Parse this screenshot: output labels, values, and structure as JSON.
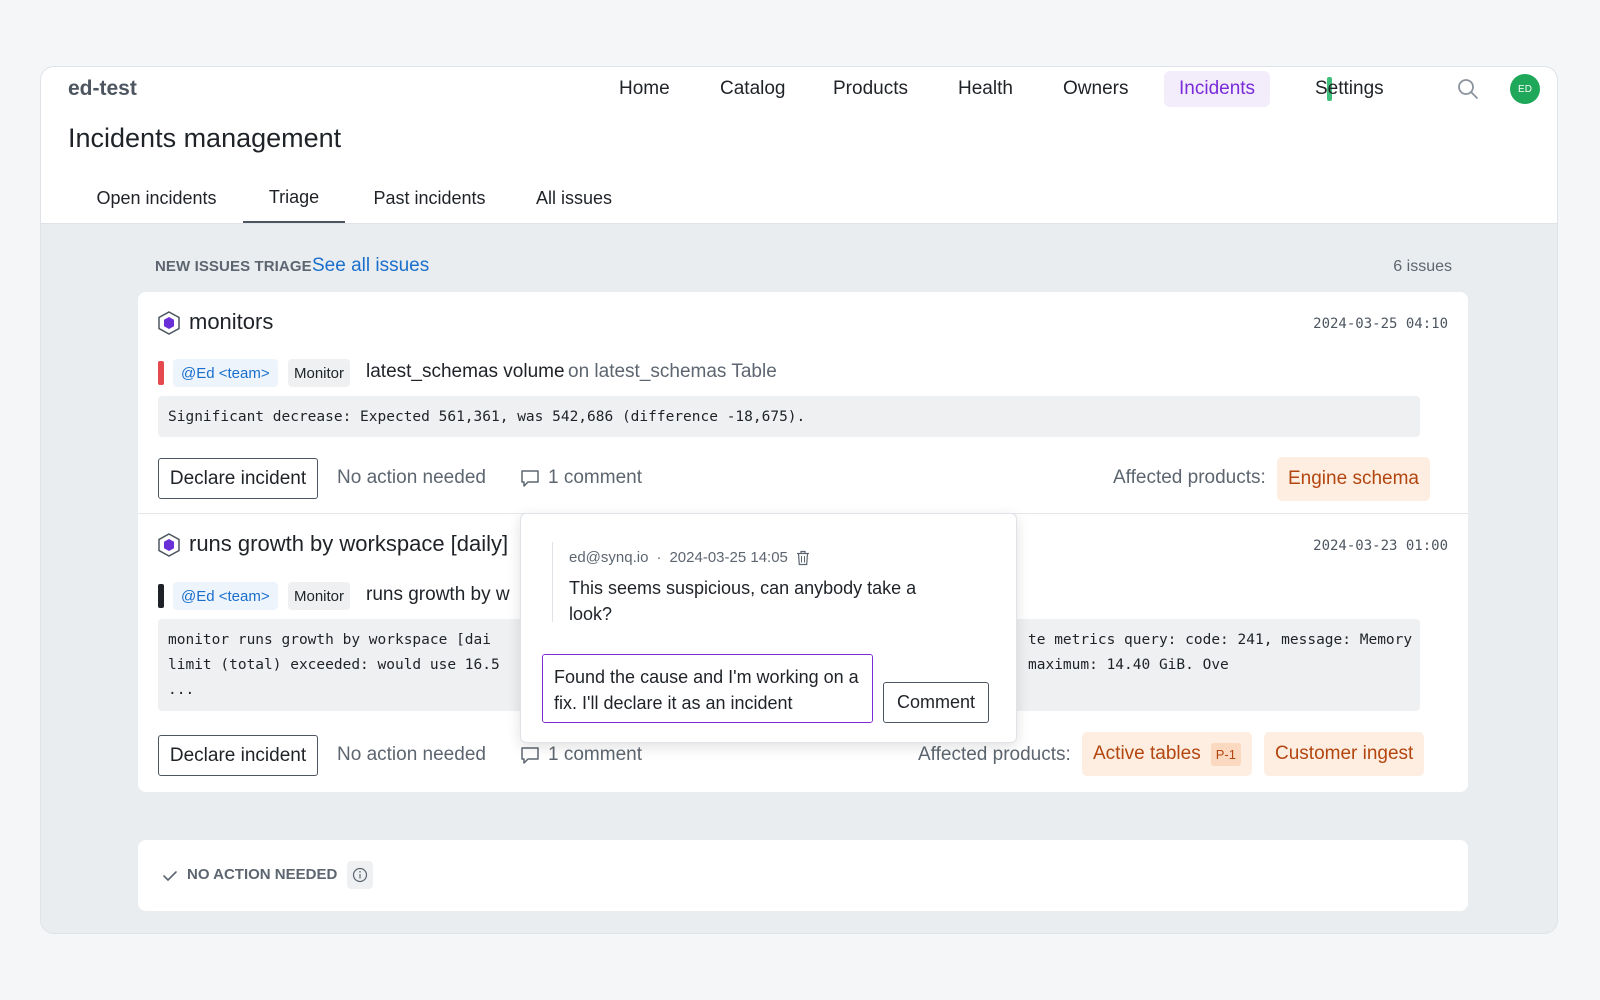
{
  "header": {
    "brand": "ed-test",
    "nav": [
      "Home",
      "Catalog",
      "Products",
      "Health",
      "Owners",
      "Incidents",
      "Settings"
    ],
    "active_nav": "Incidents",
    "avatar_initials": "ED"
  },
  "page": {
    "title": "Incidents management",
    "tabs": [
      "Open incidents",
      "Triage",
      "Past incidents",
      "All issues"
    ],
    "active_tab": "Triage"
  },
  "triage": {
    "label": "NEW ISSUES TRIAGE",
    "see_all": "See all issues",
    "count": "6 issues"
  },
  "issues": [
    {
      "title": "monitors",
      "date": "2024-03-25 04:10",
      "severity_color": "#e5484d",
      "owner": "@Ed <team>",
      "type": "Monitor",
      "check_name": "latest_schemas volume",
      "check_target": "on latest_schemas Table",
      "message": "Significant decrease: Expected 561,361, was 542,686 (difference -18,675).",
      "declare_label": "Declare incident",
      "no_action_label": "No action needed",
      "comment_label": "1 comment",
      "affected_label": "Affected products:",
      "products": [
        "Engine schema"
      ]
    },
    {
      "title": "runs growth by workspace [daily]",
      "date": "2024-03-23 01:00",
      "severity_color": "#1f2328",
      "owner": "@Ed <team>",
      "type": "Monitor",
      "check_name": "runs growth by w",
      "message_line1_left": "monitor runs growth by workspace [dai",
      "message_line1_right": "te metrics query: code: 241, message: Memory",
      "message_line2_left": "limit (total) exceeded: would use 16.5",
      "message_line2_right": "maximum: 14.40 GiB. Ove",
      "message_line3": "...",
      "declare_label": "Declare incident",
      "no_action_label": "No action needed",
      "comment_label": "1 comment",
      "affected_label": "Affected products:",
      "products": [
        "Active tables",
        "Customer ingest"
      ],
      "product_priority": "P-1"
    }
  ],
  "comment_popover": {
    "author": "ed@synq.io",
    "separator": "·",
    "timestamp": "2024-03-25 14:05",
    "body": "This seems suspicious, can anybody take a look?",
    "draft": "Found the cause and I'm working on a fix. I'll declare it as an incident",
    "submit_label": "Comment"
  },
  "no_action_section": {
    "label": "NO ACTION NEEDED"
  },
  "colors": {
    "accent": "#7a2cd9",
    "link": "#1a6fcc",
    "product_chip_bg": "#fdeee1",
    "product_chip_text": "#b3460f",
    "settings_marker": "#3fc07a",
    "avatar": "#1fa85a"
  },
  "icons": [
    "search-icon",
    "hexagon-monitor-icon",
    "comment-bubble-icon",
    "trash-icon",
    "check-icon",
    "info-icon"
  ]
}
